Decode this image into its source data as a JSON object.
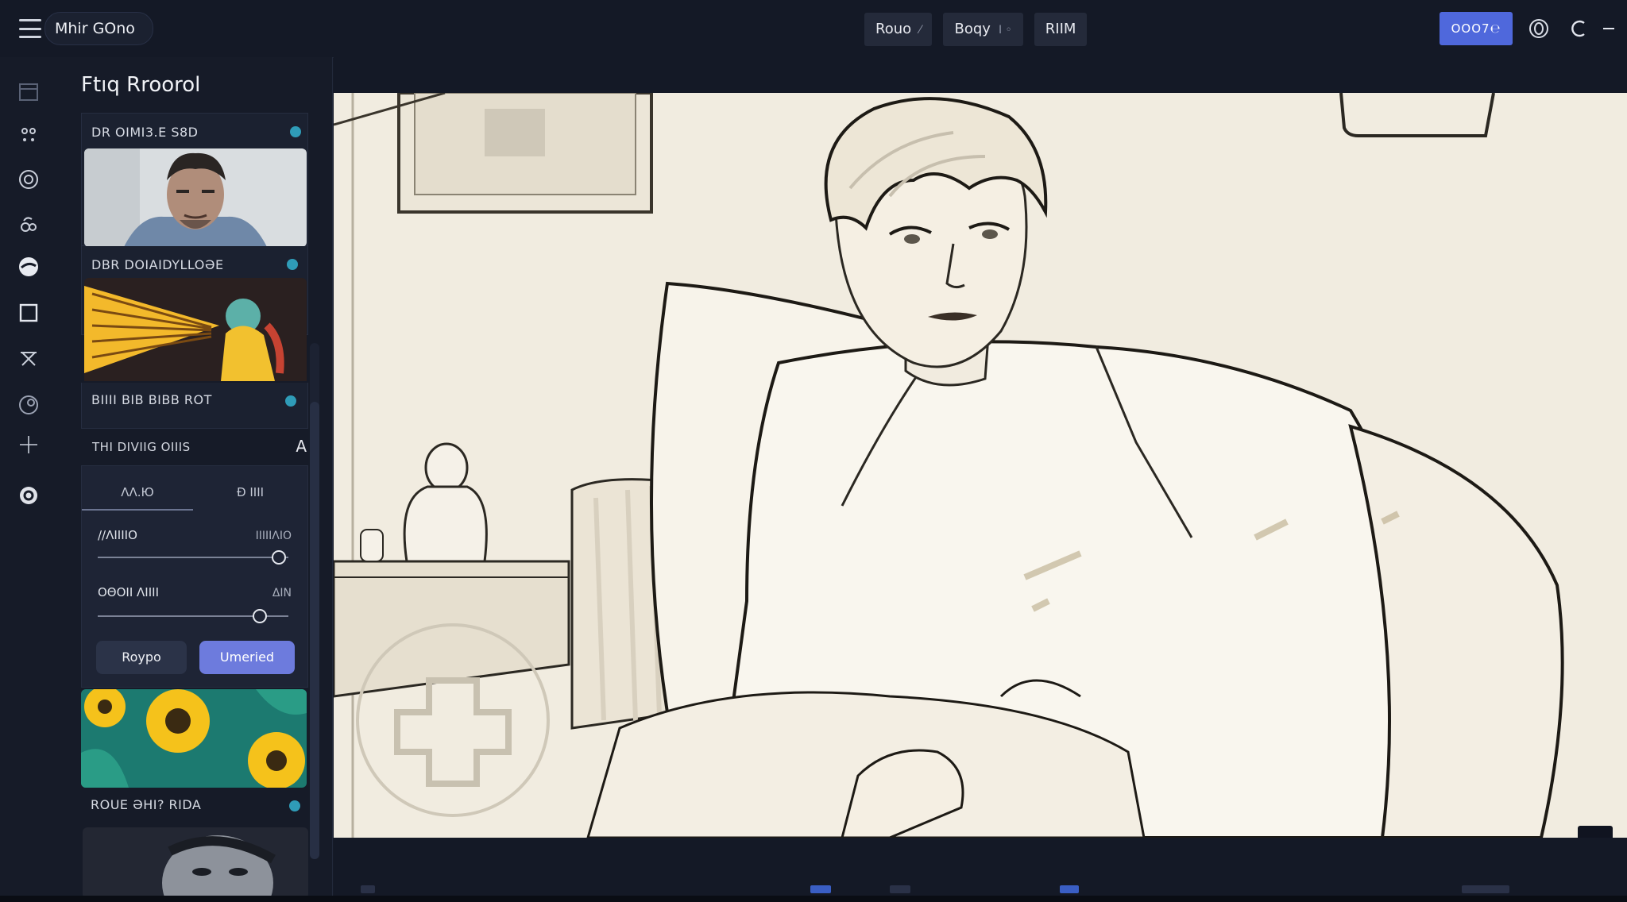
{
  "app": {
    "title": "Mhir GOno"
  },
  "top_tabs": [
    {
      "label": "Rouo",
      "suffix": "⁄"
    },
    {
      "label": "Boqy",
      "suffix": "I ◦"
    },
    {
      "label": "RIIM",
      "suffix": ""
    }
  ],
  "top_actions": {
    "primary_label": "OOO7℮"
  },
  "panel": {
    "title": "Ftıq Rroorol",
    "cards": [
      {
        "label": "DR OIMI3.E S8D"
      },
      {
        "label": "DBR DOIAIDYLLOƏE"
      },
      {
        "label": "BIIII BIB BIBB ROT"
      },
      {
        "label": "ROUE ƏHI? RIDA"
      }
    ],
    "section": {
      "label": "THI DIVIIG OIIIS",
      "toggle": "A"
    },
    "segments": [
      "ΛΛ.Ю",
      "Ð IIII"
    ],
    "sliders": [
      {
        "label": "//ΛIIIIO",
        "value": "IIIIΙΛΙΟ",
        "level": 0.95
      },
      {
        "label": "OΘOΙI ΛΙΙΙΙ",
        "value": "ΔΙΝ",
        "level": 0.85
      }
    ],
    "buttons": {
      "secondary": "Roypo",
      "primary": "Umeried"
    }
  },
  "colors": {
    "accent": "#4f68dc",
    "dot": "#2f9cb8",
    "panel_bg": "#161b28"
  }
}
